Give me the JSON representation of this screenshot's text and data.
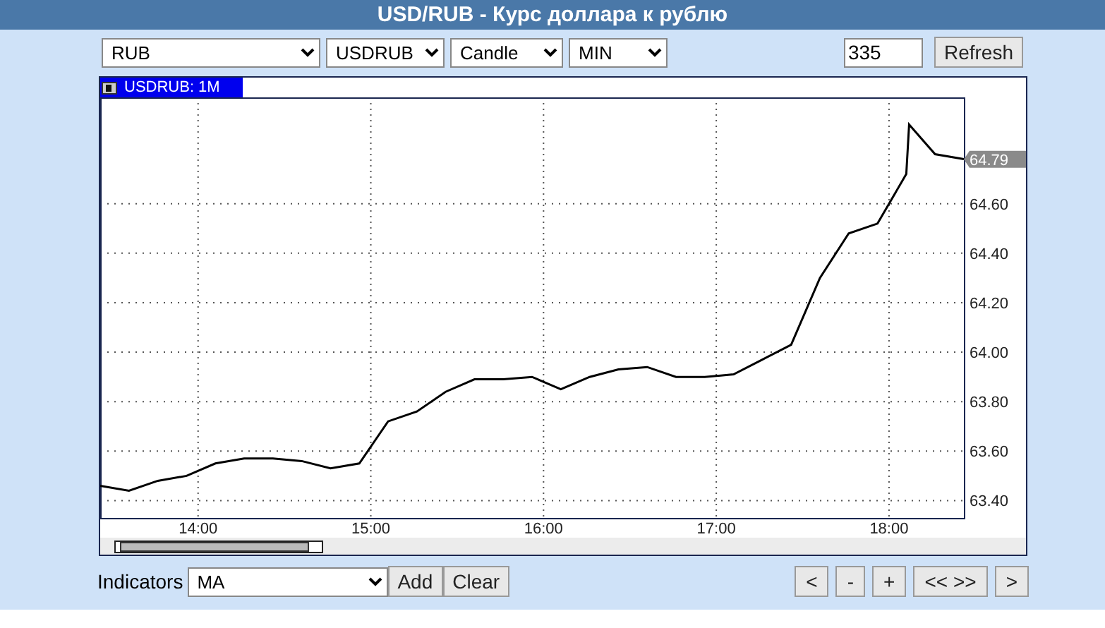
{
  "title": "USD/RUB - Курс доллара к рублю",
  "toolbar": {
    "selects": [
      {
        "value": "RUB"
      },
      {
        "value": "USDRUB"
      },
      {
        "value": "Candle"
      },
      {
        "value": "MIN"
      }
    ],
    "count_field": {
      "value": "335"
    },
    "refresh_button": "Refresh"
  },
  "chart": {
    "label": "USDRUB: 1M",
    "chart_data": {
      "type": "line",
      "x": [
        806,
        816,
        826,
        836,
        846,
        856,
        866,
        876,
        886,
        896,
        906,
        916,
        926,
        936,
        946,
        956,
        966,
        976,
        986,
        996,
        1006,
        1016,
        1026,
        1036,
        1046,
        1056,
        1066,
        1076,
        1086,
        1087,
        1096,
        1106
      ],
      "series": [
        {
          "color": "#000000",
          "values": [
            63.46,
            63.44,
            63.48,
            63.5,
            63.55,
            63.57,
            63.57,
            63.56,
            63.53,
            63.55,
            63.72,
            63.76,
            63.84,
            63.89,
            63.89,
            63.9,
            63.85,
            63.9,
            63.93,
            63.94,
            63.9,
            63.9,
            63.91,
            63.97,
            64.03,
            64.3,
            64.48,
            64.52,
            64.72,
            64.92,
            64.8,
            64.78
          ]
        }
      ],
      "xlim": [
        806,
        1106
      ],
      "ylim": [
        63.33,
        65.03
      ],
      "xticks": [
        {
          "value": 840,
          "label": "14:00"
        },
        {
          "value": 900,
          "label": "15:00"
        },
        {
          "value": 960,
          "label": "16:00"
        },
        {
          "value": 1020,
          "label": "17:00"
        },
        {
          "value": 1080,
          "label": "18:00"
        }
      ],
      "yticks": [
        {
          "value": 63.4,
          "label": "63.40"
        },
        {
          "value": 63.6,
          "label": "63.60"
        },
        {
          "value": 63.8,
          "label": "63.80"
        },
        {
          "value": 64.0,
          "label": "64.00"
        },
        {
          "value": 64.2,
          "label": "64.20"
        },
        {
          "value": 64.4,
          "label": "64.40"
        },
        {
          "value": 64.6,
          "label": "64.60"
        }
      ],
      "grid": true
    },
    "last_price": "64.79"
  },
  "footer": {
    "indicators_label": "Indicators",
    "indicator_select": {
      "value": "MA"
    },
    "buttons": [
      "Add",
      "Clear"
    ],
    "nav_buttons": [
      "<",
      "-",
      "+",
      "<< >>",
      ">"
    ]
  }
}
